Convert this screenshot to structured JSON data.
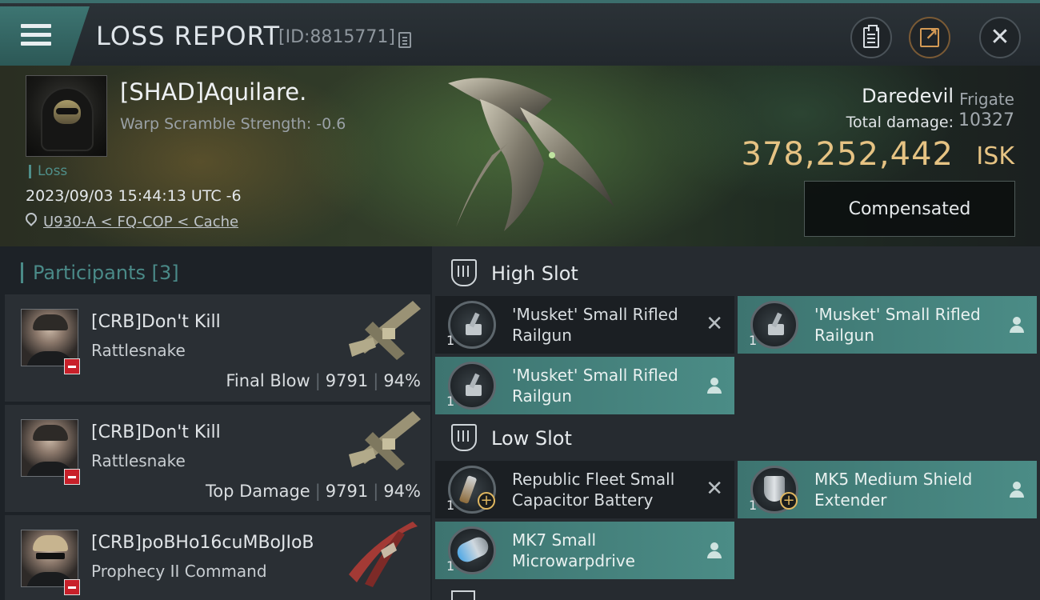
{
  "header": {
    "title": "LOSS REPORT",
    "report_id": "[ID:8815771]"
  },
  "victim": {
    "name": "[SHAD]Aquilare.",
    "warp_scramble": "Warp Scramble Strength: -0.6",
    "status": "Loss",
    "datetime": "2023/09/03 15:44:13 UTC -6",
    "location": "U930-A < FQ-COP < Cache"
  },
  "ship": {
    "name": "Daredevil",
    "class": "Frigate",
    "total_damage_label": "Total damage:",
    "total_damage": "10327",
    "isk_value": "378,252,442",
    "isk_unit": "ISK",
    "compensation_button": "Compensated"
  },
  "participants": {
    "label": "Participants",
    "count": "[3]",
    "items": [
      {
        "name": "[CRB]Don't Kill",
        "ship": "Rattlesnake",
        "role": "Final Blow",
        "damage": "9791",
        "percent": "94%"
      },
      {
        "name": "[CRB]Don't Kill",
        "ship": "Rattlesnake",
        "role": "Top Damage",
        "damage": "9791",
        "percent": "94%"
      },
      {
        "name": "[CRB]poBHo16cuMBoJIoB",
        "ship": "Prophecy II Command"
      }
    ]
  },
  "slots": {
    "high": {
      "label": "High Slot",
      "items": [
        {
          "name": "'Musket' Small Rifled Railgun",
          "qty": "1",
          "state": "destroyed"
        },
        {
          "name": "'Musket' Small Rifled Railgun",
          "qty": "1",
          "state": "dropped"
        },
        {
          "name": "'Musket' Small Rifled Railgun",
          "qty": "1",
          "state": "dropped"
        }
      ]
    },
    "low": {
      "label": "Low Slot",
      "items": [
        {
          "name": "Republic Fleet Small Capacitor Battery",
          "qty": "1",
          "state": "destroyed"
        },
        {
          "name": "MK5 Medium Shield Extender",
          "qty": "1",
          "state": "dropped"
        },
        {
          "name": "MK7 Small Microwarpdrive",
          "qty": "1",
          "state": "dropped"
        }
      ]
    }
  },
  "colors": {
    "accent": "#4b8c86",
    "isk_gold": "#e6c383",
    "minus_red": "#c8202a"
  }
}
